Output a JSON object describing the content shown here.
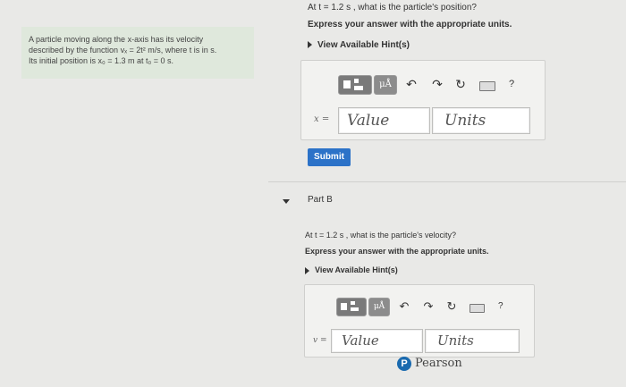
{
  "problem": {
    "line1": "A particle moving along the x-axis has its velocity",
    "line2": "described by the function vₓ = 2t² m/s, where t is in s.",
    "line3": "Its initial position is x₀ = 1.3 m at t₀ = 0 s."
  },
  "partA": {
    "question": "At t = 1.2 s , what is the particle's position?",
    "instruction": "Express your answer with the appropriate units.",
    "hint_label": "View Available Hint(s)",
    "toolbar": {
      "mu_label": "μÅ",
      "help_label": "?"
    },
    "variable_label": "x =",
    "value_placeholder": "Value",
    "units_placeholder": "Units",
    "submit_label": "Submit"
  },
  "partB": {
    "title": "Part B",
    "question": "At t = 1.2 s , what is the particle's velocity?",
    "instruction": "Express your answer with the appropriate units.",
    "hint_label": "View Available Hint(s)",
    "toolbar": {
      "mu_label": "μÅ",
      "help_label": "?"
    },
    "variable_label": "v =",
    "value_placeholder": "Value",
    "units_placeholder": "Units"
  },
  "footer": {
    "brand": "Pearson",
    "logo_letter": "P"
  },
  "colors": {
    "accent": "#2c72c8",
    "info_bg": "#dfe8dc",
    "page_bg": "#e9e9e7"
  }
}
